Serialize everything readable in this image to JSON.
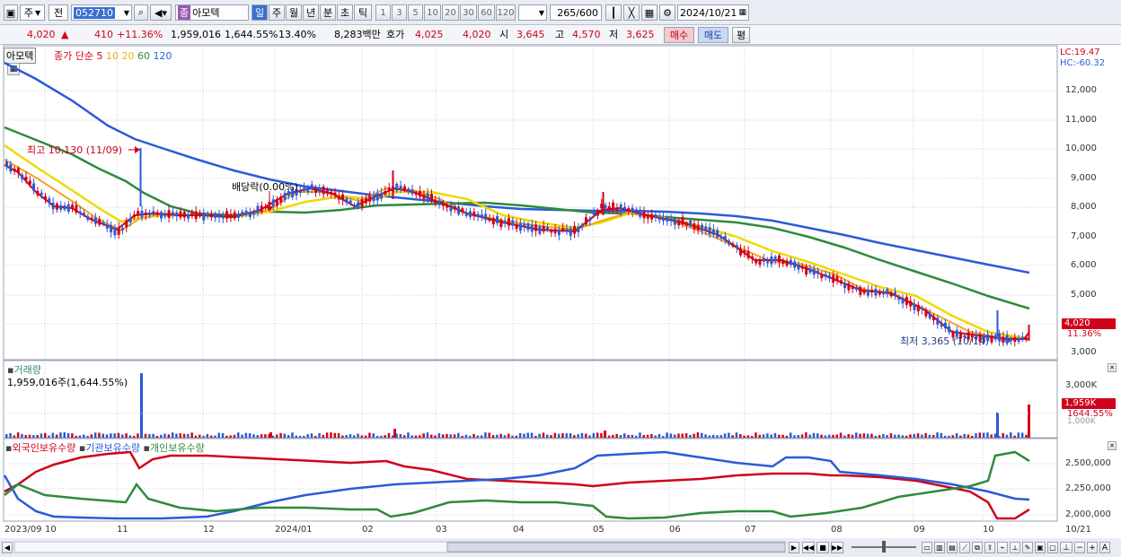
{
  "toolbar": {
    "period_label": "주",
    "prev_label": "전",
    "code_value": "052710",
    "stock_badge": "종",
    "stock_name": "아모텍",
    "period_tabs": [
      "일",
      "주",
      "월",
      "년",
      "분",
      "초",
      "틱"
    ],
    "interval_buttons": [
      "1",
      "3",
      "5",
      "10",
      "20",
      "30",
      "60",
      "120"
    ],
    "count_value": "265",
    "count_total": "/600",
    "date_value": "2024/10/21"
  },
  "quote": {
    "price": "4,020",
    "change": "410",
    "change_pct": "+11.36%",
    "volume": "1,959,016",
    "volume_pct": "1,644.55%",
    "turnover": "13.40%",
    "amount": "8,283백만",
    "bid_label": "호가",
    "bid": "4,025",
    "ask": "4,020",
    "open_label": "시",
    "open": "3,645",
    "high_label": "고",
    "high": "4,570",
    "low_label": "저",
    "low": "3,625",
    "buy_label": "매수",
    "sell_label": "매도",
    "eval_label": "평"
  },
  "price_panel": {
    "stock_name": "아모텍",
    "ma_label": "종가 단순",
    "ma_periods": [
      {
        "label": "5",
        "color": "#d0021b"
      },
      {
        "label": "10",
        "color": "#f5a623"
      },
      {
        "label": "20",
        "color": "#f0d000"
      },
      {
        "label": "60",
        "color": "#2e8b3a"
      },
      {
        "label": "120",
        "color": "#2a5bd7"
      }
    ],
    "lc": "LC:19.47",
    "hc": "HC:-60.32",
    "y_ticks": [
      "12,000",
      "11,000",
      "10,000",
      "9,000",
      "8,000",
      "7,000",
      "6,000",
      "5,000",
      "3,000"
    ],
    "high_note": "최고 10,130 (11/09)",
    "low_note": "최저 3,365 (10/14)",
    "dividend_note": "배당락(0.00%)",
    "last_price": "4,020",
    "last_pct": "11.36%"
  },
  "volume_panel": {
    "title": "거래량",
    "value": "1,959,016주(1,644.55%)",
    "y_ticks": [
      "3,000K"
    ],
    "box_value": "1,959K",
    "box_pct": "1644.55%",
    "hidden_tick": "1,000K"
  },
  "holdings_panel": {
    "series": [
      {
        "name": "외국인보유수량",
        "color": "#d0021b"
      },
      {
        "name": "기관보유수량",
        "color": "#2a5bd7"
      },
      {
        "name": "개인보유수량",
        "color": "#2e8b3a"
      }
    ],
    "y_ticks": [
      "2,500,000",
      "2,250,000",
      "2,000,000"
    ]
  },
  "x_axis": [
    "2023/09",
    "10",
    "11",
    "12",
    "2024/01",
    "02",
    "03",
    "04",
    "05",
    "06",
    "07",
    "08",
    "09",
    "10",
    "10/21"
  ],
  "colors": {
    "up": "#d0021b",
    "down": "#2a5bd7",
    "ma5": "#d0021b",
    "ma10": "#f5a623",
    "ma20": "#f0d000",
    "ma60": "#2e8b3a",
    "ma120": "#2a5bd7"
  }
}
